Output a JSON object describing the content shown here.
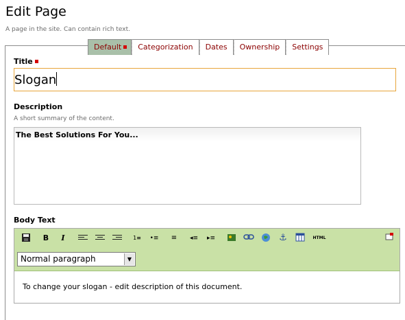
{
  "page": {
    "title": "Edit Page",
    "description": "A page in the site. Can contain rich text."
  },
  "tabs": [
    {
      "label": "Default",
      "active": true,
      "required": true
    },
    {
      "label": "Categorization"
    },
    {
      "label": "Dates"
    },
    {
      "label": "Ownership"
    },
    {
      "label": "Settings"
    }
  ],
  "fields": {
    "title": {
      "label": "Title",
      "value": "Slogan",
      "required": true
    },
    "description": {
      "label": "Description",
      "help": "A short summary of the content.",
      "value": "The Best Solutions For You..."
    },
    "body": {
      "label": "Body Text",
      "format": "Normal paragraph",
      "value": "To change your slogan - edit description of this document."
    }
  },
  "toolbar": {
    "html_label": "HTML",
    "buttons": [
      "save-icon",
      "bold-icon",
      "italic-icon",
      "align-left-icon",
      "align-center-icon",
      "align-right-icon",
      "numbered-list-icon",
      "bullet-list-icon",
      "definition-list-icon",
      "outdent-icon",
      "indent-icon",
      "insert-image-icon",
      "insert-link-icon",
      "external-link-icon",
      "anchor-icon",
      "table-icon",
      "html-icon",
      "fullscreen-icon"
    ]
  },
  "colors": {
    "accent": "#8b0000",
    "tab_active": "#a9c0a9",
    "toolbar": "#c9e1a6",
    "focus_border": "#e8a53a",
    "required": "#d40000"
  }
}
